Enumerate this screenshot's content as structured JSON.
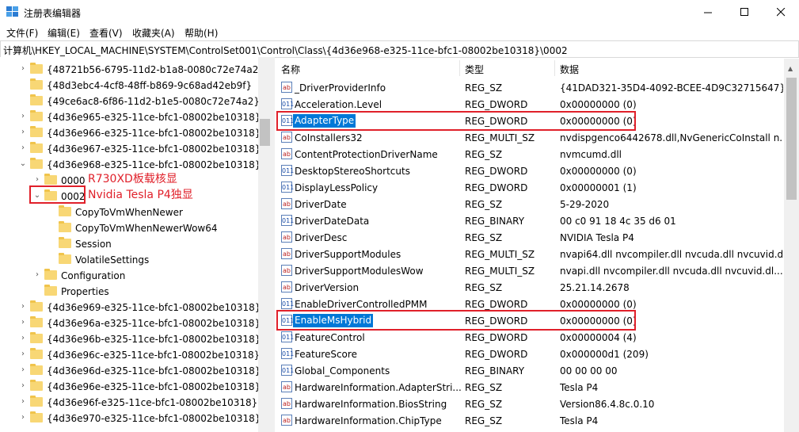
{
  "window": {
    "title": "注册表编辑器",
    "controls": [
      "minimize",
      "maximize",
      "close"
    ]
  },
  "menu": [
    "文件(F)",
    "编辑(E)",
    "查看(V)",
    "收藏夹(A)",
    "帮助(H)"
  ],
  "address": "计算机\\HKEY_LOCAL_MACHINE\\SYSTEM\\ControlSet001\\Control\\Class\\{4d36e968-e325-11ce-bfc1-08002be10318}\\0002",
  "tree": {
    "items": [
      {
        "label": "{48721b56-6795-11d2-b1a8-0080c72e74a2}",
        "level": 1,
        "expander": "›"
      },
      {
        "label": "{48d3ebc4-4cf8-48ff-b869-9c68ad42eb9f}",
        "level": 1,
        "expander": ""
      },
      {
        "label": "{49ce6ac8-6f86-11d2-b1e5-0080c72e74a2}",
        "level": 1,
        "expander": ""
      },
      {
        "label": "{4d36e965-e325-11ce-bfc1-08002be10318}",
        "level": 1,
        "expander": "›"
      },
      {
        "label": "{4d36e966-e325-11ce-bfc1-08002be10318}",
        "level": 1,
        "expander": "›"
      },
      {
        "label": "{4d36e967-e325-11ce-bfc1-08002be10318}",
        "level": 1,
        "expander": "›"
      },
      {
        "label": "{4d36e968-e325-11ce-bfc1-08002be10318}",
        "level": 1,
        "expander": "⌄"
      },
      {
        "label": "0000",
        "level": 2,
        "expander": "›"
      },
      {
        "label": "0002",
        "level": 2,
        "expander": "⌄"
      },
      {
        "label": "CopyToVmWhenNewer",
        "level": 3,
        "expander": ""
      },
      {
        "label": "CopyToVmWhenNewerWow64",
        "level": 3,
        "expander": ""
      },
      {
        "label": "Session",
        "level": 3,
        "expander": ""
      },
      {
        "label": "VolatileSettings",
        "level": 3,
        "expander": ""
      },
      {
        "label": "Configuration",
        "level": 2,
        "expander": "›"
      },
      {
        "label": "Properties",
        "level": 2,
        "expander": ""
      },
      {
        "label": "{4d36e969-e325-11ce-bfc1-08002be10318}",
        "level": 1,
        "expander": "›"
      },
      {
        "label": "{4d36e96a-e325-11ce-bfc1-08002be10318}",
        "level": 1,
        "expander": "›"
      },
      {
        "label": "{4d36e96b-e325-11ce-bfc1-08002be10318}",
        "level": 1,
        "expander": "›"
      },
      {
        "label": "{4d36e96c-e325-11ce-bfc1-08002be10318}",
        "level": 1,
        "expander": "›"
      },
      {
        "label": "{4d36e96d-e325-11ce-bfc1-08002be10318}",
        "level": 1,
        "expander": "›"
      },
      {
        "label": "{4d36e96e-e325-11ce-bfc1-08002be10318}",
        "level": 1,
        "expander": "›"
      },
      {
        "label": "{4d36e96f-e325-11ce-bfc1-08002be10318}",
        "level": 1,
        "expander": "›"
      },
      {
        "label": "{4d36e970-e325-11ce-bfc1-08002be10318}",
        "level": 1,
        "expander": "›"
      }
    ]
  },
  "annotations": {
    "node_0000": "R730XD板载核显",
    "node_0002": "Nvidia Tesla P4独显"
  },
  "list": {
    "headers": {
      "name": "名称",
      "type": "类型",
      "data": "数据"
    },
    "rows": [
      {
        "icon": "string",
        "name": "_DriverProviderInfo",
        "type": "REG_SZ",
        "data": "{41DAD321-35D4-4092-BCEE-4D9C32715647}"
      },
      {
        "icon": "binary",
        "name": "Acceleration.Level",
        "type": "REG_DWORD",
        "data": "0x00000000 (0)"
      },
      {
        "icon": "binary",
        "name": "AdapterType",
        "type": "REG_DWORD",
        "data": "0x00000000 (0)",
        "selected": true
      },
      {
        "icon": "string",
        "name": "CoInstallers32",
        "type": "REG_MULTI_SZ",
        "data": "nvdispgenco6442678.dll,NvGenericCoInstall n..."
      },
      {
        "icon": "string",
        "name": "ContentProtectionDriverName",
        "type": "REG_SZ",
        "data": "nvmcumd.dll"
      },
      {
        "icon": "binary",
        "name": "DesktopStereoShortcuts",
        "type": "REG_DWORD",
        "data": "0x00000000 (0)"
      },
      {
        "icon": "binary",
        "name": "DisplayLessPolicy",
        "type": "REG_DWORD",
        "data": "0x00000001 (1)"
      },
      {
        "icon": "string",
        "name": "DriverDate",
        "type": "REG_SZ",
        "data": "5-29-2020"
      },
      {
        "icon": "binary",
        "name": "DriverDateData",
        "type": "REG_BINARY",
        "data": "00 c0 91 18 4c 35 d6 01"
      },
      {
        "icon": "string",
        "name": "DriverDesc",
        "type": "REG_SZ",
        "data": "NVIDIA Tesla P4"
      },
      {
        "icon": "string",
        "name": "DriverSupportModules",
        "type": "REG_MULTI_SZ",
        "data": "nvapi64.dll nvcompiler.dll nvcuda.dll nvcuvid.d..."
      },
      {
        "icon": "string",
        "name": "DriverSupportModulesWow",
        "type": "REG_MULTI_SZ",
        "data": "nvapi.dll nvcompiler.dll nvcuda.dll nvcuvid.dl..."
      },
      {
        "icon": "string",
        "name": "DriverVersion",
        "type": "REG_SZ",
        "data": "25.21.14.2678"
      },
      {
        "icon": "binary",
        "name": "EnableDriverControlledPMM",
        "type": "REG_DWORD",
        "data": "0x00000000 (0)"
      },
      {
        "icon": "binary",
        "name": "EnableMsHybrid",
        "type": "REG_DWORD",
        "data": "0x00000000 (0)",
        "selected": true
      },
      {
        "icon": "binary",
        "name": "FeatureControl",
        "type": "REG_DWORD",
        "data": "0x00000004 (4)"
      },
      {
        "icon": "binary",
        "name": "FeatureScore",
        "type": "REG_DWORD",
        "data": "0x000000d1 (209)"
      },
      {
        "icon": "binary",
        "name": "Global_Components",
        "type": "REG_BINARY",
        "data": "00 00 00 00"
      },
      {
        "icon": "string",
        "name": "HardwareInformation.AdapterStri...",
        "type": "REG_SZ",
        "data": "Tesla P4"
      },
      {
        "icon": "string",
        "name": "HardwareInformation.BiosString",
        "type": "REG_SZ",
        "data": "Version86.4.8c.0.10"
      },
      {
        "icon": "string",
        "name": "HardwareInformation.ChipType",
        "type": "REG_SZ",
        "data": "Tesla P4"
      }
    ]
  },
  "colors": {
    "highlight": "#e0202a",
    "selection": "#0078d7",
    "folder": "#f8d775"
  }
}
